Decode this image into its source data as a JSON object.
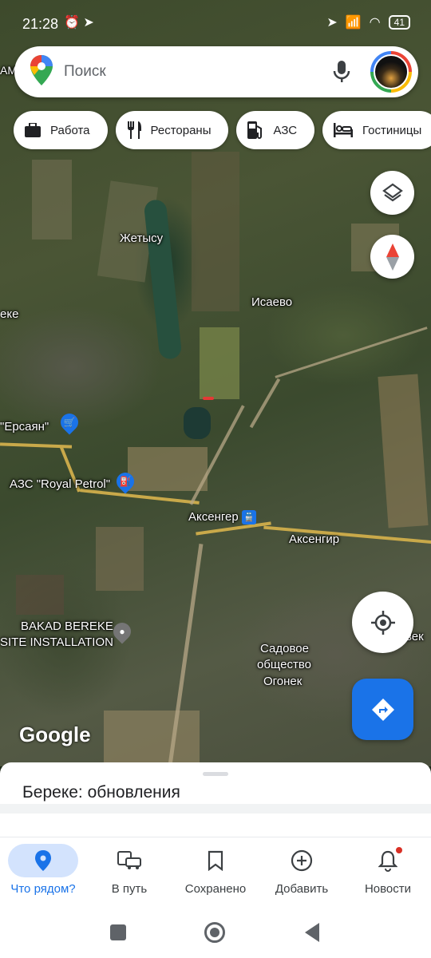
{
  "status_bar": {
    "time": "21:28",
    "battery": "41"
  },
  "search": {
    "placeholder": "Поиск"
  },
  "chips": [
    {
      "label": "Работа",
      "icon": "briefcase-icon"
    },
    {
      "label": "Рестораны",
      "icon": "restaurant-icon"
    },
    {
      "label": "АЗС",
      "icon": "gas-station-icon"
    },
    {
      "label": "Гостиницы",
      "icon": "hotel-icon"
    }
  ],
  "map": {
    "labels": {
      "zhetysu": "Жетысу",
      "isaevo": "Исаево",
      "eke": "еке",
      "ersayan": "\"Ерсаян\"",
      "royal_petrol": "АЗС \"Royal Petrol\"",
      "aksenger_station": "Аксенгер",
      "aksengir": "Аксенгир",
      "bakad_line1": "BAKAD BEREKE",
      "bakad_line2": "SITE INSTALLATION",
      "sadovoe_line1": "Садовое",
      "sadovoe_line2": "общество",
      "sadovoe_line3": "Огонек",
      "vek": "век",
      "am": "AM",
      "google": "Google"
    }
  },
  "sheet": {
    "title": "Береке: обновления"
  },
  "nav": [
    {
      "label": "Что рядом?",
      "icon": "location-pin-icon",
      "active": true
    },
    {
      "label": "В путь",
      "icon": "commute-icon",
      "active": false
    },
    {
      "label": "Сохранено",
      "icon": "bookmark-icon",
      "active": false
    },
    {
      "label": "Добавить",
      "icon": "add-circle-icon",
      "active": false
    },
    {
      "label": "Новости",
      "icon": "bell-icon",
      "active": false
    }
  ],
  "colors": {
    "accent": "#1a73e8",
    "directions": "#1a73e8",
    "active_nav_bg": "#d3e3fd"
  }
}
